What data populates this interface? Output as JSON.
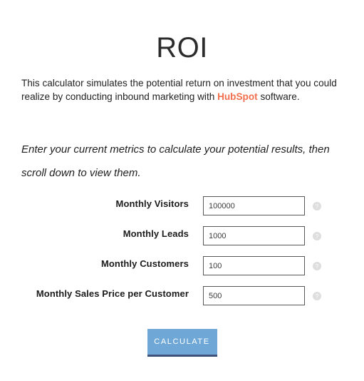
{
  "page": {
    "title": "ROI",
    "intro": {
      "before": "This calculator simulates the potential return on investment that you could realize by conducting inbound marketing with ",
      "link": "HubSpot",
      "after": " software."
    },
    "instruction": "Enter your current metrics to calculate your potential results, then scroll down to view them."
  },
  "form": {
    "fields": [
      {
        "label": "Monthly Visitors",
        "value": "100000",
        "placeholder": "",
        "help_icon": "help-circle-icon"
      },
      {
        "label": "Monthly Leads",
        "value": "1000",
        "placeholder": "",
        "help_icon": "help-circle-icon"
      },
      {
        "label": "Monthly Customers",
        "value": "100",
        "placeholder": "",
        "help_icon": "help-circle-icon"
      },
      {
        "label": "Monthly Sales Price per Customer",
        "value": "500",
        "placeholder": "",
        "help_icon": "help-circle-icon"
      }
    ],
    "submit_label": "CALCULATE"
  },
  "colors": {
    "brand_orange": "#F2704E",
    "button_blue": "#6FA8D6",
    "button_shadow": "#3F5277",
    "help_gray": "#DCDCDC",
    "input_border": "#575757"
  }
}
